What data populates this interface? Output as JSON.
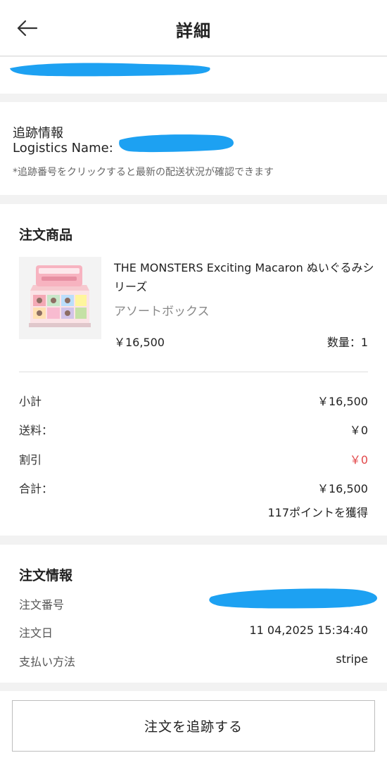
{
  "header": {
    "title": "詳細"
  },
  "tracking": {
    "title": "追跡情報",
    "logistics_label": "Logistics Name:",
    "note": "*追跡番号をクリックすると最新の配送状況が確認できます"
  },
  "order_items": {
    "title": "注文商品",
    "product": {
      "name": "THE MONSTERS Exciting Macaron ぬいぐるみシリーズ",
      "variant": "アソートボックス",
      "price": "￥16,500",
      "quantity": "数量：1"
    }
  },
  "summary": {
    "subtotal_label": "小計",
    "subtotal_value": "￥16,500",
    "shipping_label": "送料：",
    "shipping_value": "￥0",
    "discount_label": "割引",
    "discount_value": "￥0",
    "total_label": "合計：",
    "total_value": "￥16,500",
    "points_note": "117ポイントを獲得"
  },
  "order_info": {
    "title": "注文情報",
    "number_label": "注文番号",
    "date_label": "注文日",
    "date_value": "11 04,2025 15:34:40",
    "payment_label": "支払い方法",
    "payment_value": "stripe"
  },
  "actions": {
    "track_order": "注文を追跡する"
  },
  "colors": {
    "redaction": "#1da1f2",
    "discount_red": "#e2484a",
    "background": "#f2f2f2"
  }
}
